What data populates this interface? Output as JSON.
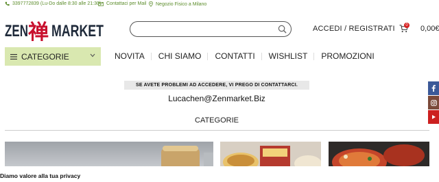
{
  "topbar": {
    "phone": "3397772839 (Lu-Do dalle 8:30 alle 21:30)",
    "contact_mail": "Contattaci per Mail",
    "store": "Negozio Fisico a Milano"
  },
  "logo": {
    "left": "ZEN",
    "middle": "禅",
    "right": "MARKET"
  },
  "search": {
    "placeholder": ""
  },
  "header": {
    "login": "ACCEDI / REGISTRATI",
    "cart_count": "0",
    "cart_total": "0,00€"
  },
  "categories_button": "CATEGORIE",
  "nav": [
    "NOVITA",
    "CHI SIAMO",
    "CONTATTI",
    "WISHLIST",
    "PROMOZIONI"
  ],
  "notice": "SE AVETE PROBLEMI AD ACCEDERE, VI PREGO DI CONTATTARCI.",
  "email": "Lucachen@Zenmarket.Biz",
  "categories_title": "CATEGORIE",
  "privacy": "Diamo valore alla tua privacy",
  "social": [
    {
      "name": "facebook-icon",
      "color": "#3b5998"
    },
    {
      "name": "instagram-icon",
      "color": "#7b4a3a"
    },
    {
      "name": "youtube-icon",
      "color": "#cc1f1f"
    }
  ],
  "colors": {
    "accent_green": "#5b8c2a",
    "category_bg": "#d9e8b0",
    "logo_red": "#c8102e",
    "logo_dark": "#1f2a3a"
  }
}
